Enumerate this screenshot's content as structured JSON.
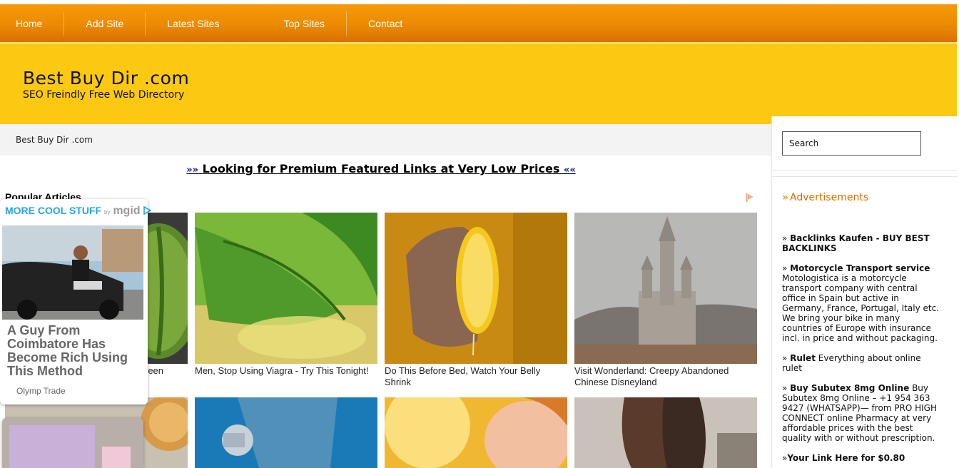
{
  "nav": {
    "items": [
      "Home",
      "Add Site",
      "Latest Sites",
      "Top Sites",
      "Contact"
    ]
  },
  "header": {
    "title": "Best Buy Dir .com",
    "tagline": "SEO Freindly Free Web Directory"
  },
  "breadcrumb": "Best Buy Dir .com",
  "promo": {
    "arrows_left": "»»",
    "text": "Looking for Premium Featured Links at Very Low Prices",
    "arrows_right": "««"
  },
  "popular_title": "Popular Articles",
  "tiles": [
    {
      "caption": "reen",
      "icon": "melon-image"
    },
    {
      "caption": "Men, Stop Using Viagra - Try This Tonight!",
      "icon": "aloe-image"
    },
    {
      "caption": "Do This Before Bed, Watch Your Belly Shrink",
      "icon": "lemon-hand-image"
    },
    {
      "caption": "Visit Wonderland: Creepy Abandoned Chinese Disneyland",
      "icon": "castle-image"
    }
  ],
  "mgid": {
    "header": "MORE COOL STUFF",
    "by": "by",
    "brand": "mgid",
    "card_title": "A Guy From Coimbatore Has Become Rich Using This Method",
    "card_source": "Olymp Trade"
  },
  "sidebar": {
    "search_placeholder": "Search",
    "ads_title": "Advertisements",
    "ads": [
      {
        "title": "Backlinks Kaufen - BUY BEST BACKLINKS",
        "desc": ""
      },
      {
        "title": "Motorcycle Transport service",
        "desc": "Motologistica is a motorcycle transport company with central office in Spain but active in Germany, France, Portugal, Italy etc. We bring your bike in many countries of Europe with insurance incl. in price and without packaging."
      },
      {
        "title": "Rulet",
        "desc": "Everything about online rulet"
      },
      {
        "title": "Buy Subutex 8mg Online",
        "desc": "Buy Subutex 8mg Online – +1 954 363 9427 (WHATSAPP)— from PRO HIGH CONNECT online Pharmacy at very affordable prices with the best quality with or without prescription."
      },
      {
        "title": "Your Link Here for $0.80",
        "desc": ""
      }
    ]
  },
  "colors": {
    "nav_orange": "#ec8a02",
    "header_yellow": "#fbc812",
    "mgid_blue": "#24a4dd",
    "ads_title": "#d46b00"
  }
}
